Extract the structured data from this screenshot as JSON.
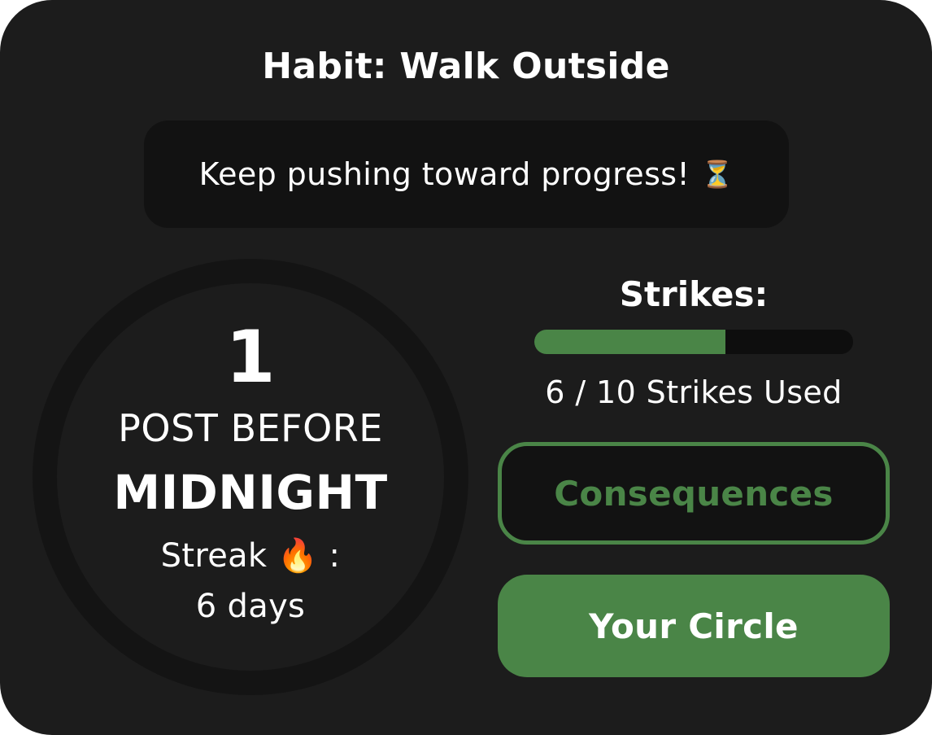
{
  "header": {
    "title": "Habit: Walk Outside"
  },
  "motivation": {
    "text": "Keep pushing toward progress!",
    "emoji": "⏳"
  },
  "status_ring": {
    "count": "1",
    "label": "POST BEFORE",
    "deadline": "MIDNIGHT",
    "streak_label": "Streak",
    "streak_emoji": "🔥",
    "streak_separator": ":",
    "streak_value": "6 days"
  },
  "strikes": {
    "title": "Strikes:",
    "used": 6,
    "total": 10,
    "used_text": "6 / 10 Strikes Used"
  },
  "actions": {
    "consequences_label": "Consequences",
    "circle_label": "Your Circle"
  },
  "colors": {
    "card_background": "#1c1c1c",
    "panel_background": "#121212",
    "accent_green": "#4a8547",
    "text": "#ffffff"
  }
}
